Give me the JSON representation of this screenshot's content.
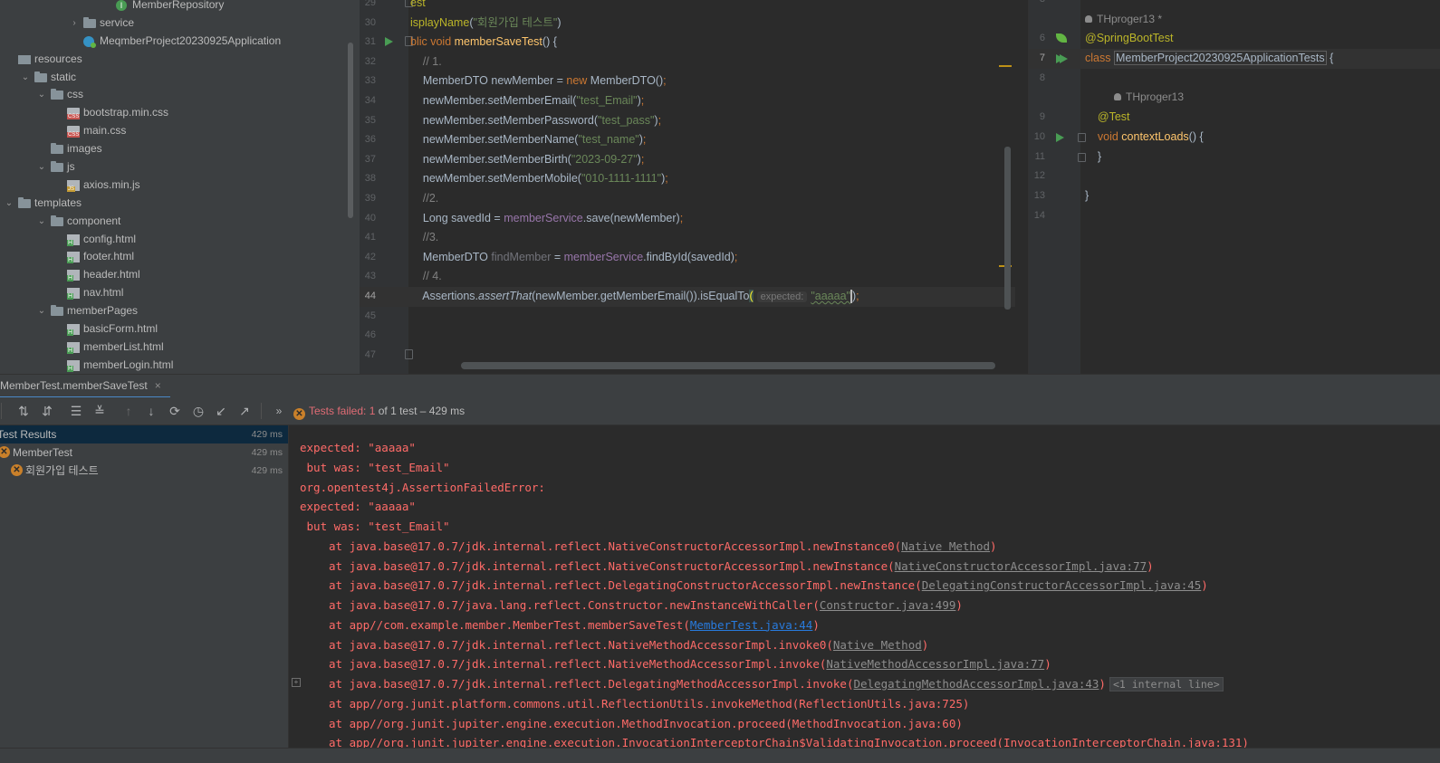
{
  "project_tree": {
    "items": [
      {
        "label": "MemberRepository",
        "icon": "interface-icon",
        "depth": 6,
        "arrow": ""
      },
      {
        "label": "service",
        "icon": "folder-icon",
        "depth": 4,
        "arrow": "collapsed"
      },
      {
        "label": "MeqmberProject20230925Application",
        "icon": "spring-app-icon",
        "depth": 4,
        "arrow": ""
      },
      {
        "label": "resources",
        "icon": "resources-folder-icon",
        "depth": 0,
        "arrow": ""
      },
      {
        "label": "static",
        "icon": "folder-icon",
        "depth": 1,
        "arrow": "expanded"
      },
      {
        "label": "css",
        "icon": "folder-icon",
        "depth": 2,
        "arrow": "expanded"
      },
      {
        "label": "bootstrap.min.css",
        "icon": "css-file-icon",
        "depth": 3,
        "arrow": ""
      },
      {
        "label": "main.css",
        "icon": "css-file-icon",
        "depth": 3,
        "arrow": ""
      },
      {
        "label": "images",
        "icon": "folder-icon",
        "depth": 2,
        "arrow": ""
      },
      {
        "label": "js",
        "icon": "folder-icon",
        "depth": 2,
        "arrow": "expanded"
      },
      {
        "label": "axios.min.js",
        "icon": "js-file-icon",
        "depth": 3,
        "arrow": ""
      },
      {
        "label": "templates",
        "icon": "folder-icon",
        "depth": 0,
        "arrow": "expanded"
      },
      {
        "label": "component",
        "icon": "folder-icon",
        "depth": 2,
        "arrow": "expanded"
      },
      {
        "label": "config.html",
        "icon": "html-file-icon",
        "depth": 3,
        "arrow": ""
      },
      {
        "label": "footer.html",
        "icon": "html-file-icon",
        "depth": 3,
        "arrow": ""
      },
      {
        "label": "header.html",
        "icon": "html-file-icon",
        "depth": 3,
        "arrow": ""
      },
      {
        "label": "nav.html",
        "icon": "html-file-icon",
        "depth": 3,
        "arrow": ""
      },
      {
        "label": "memberPages",
        "icon": "folder-icon",
        "depth": 2,
        "arrow": "expanded"
      },
      {
        "label": "basicForm.html",
        "icon": "html-file-icon",
        "depth": 3,
        "arrow": ""
      },
      {
        "label": "memberList.html",
        "icon": "html-file-icon",
        "depth": 3,
        "arrow": ""
      },
      {
        "label": "memberLogin.html",
        "icon": "html-file-icon",
        "depth": 3,
        "arrow": ""
      }
    ]
  },
  "editor_left": {
    "current_line": 44,
    "lines": [
      {
        "n": 29,
        "marker": "fold",
        "t": [
          [
            "ann",
            "est"
          ]
        ]
      },
      {
        "n": 30,
        "t": [
          [
            "ann",
            "isplayName"
          ],
          [
            "",
            "("
          ],
          [
            "str",
            "\"회원가입 테스트\""
          ],
          [
            "",
            ")"
          ]
        ]
      },
      {
        "n": 31,
        "marker": "run-fold",
        "t": [
          [
            "kw",
            "blic void "
          ],
          [
            "fn",
            "memberSaveTest"
          ],
          [
            "",
            "() {"
          ]
        ]
      },
      {
        "n": 32,
        "t": [
          [
            "cm",
            "    // 1."
          ]
        ]
      },
      {
        "n": 33,
        "t": [
          [
            "",
            "    MemberDTO newMember = "
          ],
          [
            "kw",
            "new "
          ],
          [
            "",
            "MemberDTO()"
          ],
          [
            "kw",
            ";"
          ]
        ]
      },
      {
        "n": 34,
        "t": [
          [
            "",
            "    newMember.setMemberEmail("
          ],
          [
            "str",
            "\"test_Email\""
          ],
          [
            "",
            ")"
          ],
          [
            "kw",
            ";"
          ]
        ]
      },
      {
        "n": 35,
        "t": [
          [
            "",
            "    newMember.setMemberPassword("
          ],
          [
            "str",
            "\"test_pass\""
          ],
          [
            "",
            ")"
          ],
          [
            "kw",
            ";"
          ]
        ]
      },
      {
        "n": 36,
        "t": [
          [
            "",
            "    newMember.setMemberName("
          ],
          [
            "str",
            "\"test_name\""
          ],
          [
            "",
            ")"
          ],
          [
            "kw",
            ";"
          ]
        ]
      },
      {
        "n": 37,
        "t": [
          [
            "",
            "    newMember.setMemberBirth("
          ],
          [
            "str",
            "\"2023-09-27\""
          ],
          [
            "",
            ")"
          ],
          [
            "kw",
            ";"
          ]
        ]
      },
      {
        "n": 38,
        "t": [
          [
            "",
            "    newMember.setMemberMobile("
          ],
          [
            "str",
            "\"010-1111-1111\""
          ],
          [
            "",
            ")"
          ],
          [
            "kw",
            ";"
          ]
        ]
      },
      {
        "n": 39,
        "t": [
          [
            "cm",
            "    //2."
          ]
        ]
      },
      {
        "n": 40,
        "t": [
          [
            "",
            "    Long savedId = "
          ],
          [
            "fld",
            "memberService"
          ],
          [
            "",
            ".save(newMember)"
          ],
          [
            "kw",
            ";"
          ]
        ]
      },
      {
        "n": 41,
        "t": [
          [
            "cm",
            "    //3."
          ]
        ]
      },
      {
        "n": 42,
        "t": [
          [
            "",
            "    MemberDTO "
          ],
          [
            "unused",
            "findMember"
          ],
          [
            "",
            " = "
          ],
          [
            "fld",
            "memberService"
          ],
          [
            "",
            ".findById(savedId)"
          ],
          [
            "kw",
            ";"
          ]
        ]
      },
      {
        "n": 43,
        "t": [
          [
            "cm",
            "    // 4."
          ]
        ]
      },
      {
        "n": 44,
        "t": [
          [
            "",
            "    Assertions."
          ],
          [
            "ital",
            "assertThat"
          ],
          [
            "",
            "(newMember.getMemberEmail()).isEqualTo"
          ],
          [
            "paren",
            "("
          ],
          [
            "hint",
            "expected:"
          ],
          [
            "strtypo",
            "\"aaaaa\""
          ],
          [
            "caret",
            ""
          ],
          [
            "",
            ")"
          ],
          [
            "kw",
            ";"
          ]
        ]
      },
      {
        "n": 45,
        "t": []
      },
      {
        "n": 46,
        "t": []
      },
      {
        "n": 47,
        "marker": "fold",
        "t": []
      }
    ]
  },
  "editor_right": {
    "current_line": 7,
    "lines": [
      {
        "n": "3",
        "t": []
      },
      {
        "n": "",
        "author": "THproger13 *",
        "indent": 0
      },
      {
        "n": "6",
        "marker": "leaf",
        "t": [
          [
            "ann",
            "@SpringBootTest"
          ]
        ]
      },
      {
        "n": "7",
        "marker": "run2",
        "t": [
          [
            "kw",
            "class "
          ],
          [
            "cls",
            "MemberProject20230925ApplicationTests"
          ],
          [
            "",
            " {"
          ]
        ]
      },
      {
        "n": "8",
        "t": []
      },
      {
        "n": "",
        "author": "THproger13",
        "indent": 1
      },
      {
        "n": "9",
        "t": [
          [
            "ann",
            "    @Test"
          ]
        ]
      },
      {
        "n": "10",
        "marker": "run-fold",
        "t": [
          [
            "kw",
            "    void "
          ],
          [
            "fn",
            "contextLoads"
          ],
          [
            "",
            "() {"
          ]
        ]
      },
      {
        "n": "11",
        "marker": "fold",
        "t": [
          [
            "",
            "    }"
          ]
        ]
      },
      {
        "n": "12",
        "t": []
      },
      {
        "n": "13",
        "t": [
          [
            "",
            "}"
          ]
        ]
      },
      {
        "n": "14",
        "t": []
      }
    ]
  },
  "run_panel": {
    "tab_label": "MemberTest.memberSaveTest",
    "tab_close": "×",
    "status": {
      "prefix": "Tests failed:",
      "count": "1",
      "suffix": "of 1 test – 429 ms"
    },
    "results": [
      {
        "label": "Test Results",
        "time": "429 ms",
        "depth": 0,
        "status": "",
        "selected": true
      },
      {
        "label": "MemberTest",
        "time": "429 ms",
        "depth": 0,
        "status": "failed",
        "selected": false
      },
      {
        "label": "회원가입 테스트",
        "time": "429 ms",
        "depth": 1,
        "status": "failed",
        "selected": false
      }
    ],
    "console": [
      {
        "t": "expected: \"aaaaa\""
      },
      {
        "t": " but was: \"test_Email\""
      },
      {
        "t": "org.opentest4j.AssertionFailedError:"
      },
      {
        "t": "expected: \"aaaaa\""
      },
      {
        "t": " but was: \"test_Email\""
      },
      {
        "at": "at java.base@17.0.7/jdk.internal.reflect.NativeConstructorAccessorImpl.newInstance0(",
        "link": "Native Method",
        "end": ")"
      },
      {
        "at": "at java.base@17.0.7/jdk.internal.reflect.NativeConstructorAccessorImpl.newInstance(",
        "link": "NativeConstructorAccessorImpl.java:77",
        "end": ")"
      },
      {
        "at": "at java.base@17.0.7/jdk.internal.reflect.DelegatingConstructorAccessorImpl.newInstance(",
        "link": "DelegatingConstructorAccessorImpl.java:45",
        "end": ")"
      },
      {
        "at": "at java.base@17.0.7/java.lang.reflect.Constructor.newInstanceWithCaller(",
        "link": "Constructor.java:499",
        "end": ")"
      },
      {
        "at": "at app//com.example.member.MemberTest.memberSaveTest(",
        "link": "MemberTest.java:44",
        "end": ")",
        "user": true
      },
      {
        "at": "at java.base@17.0.7/jdk.internal.reflect.NativeMethodAccessorImpl.invoke0(",
        "link": "Native Method",
        "end": ")"
      },
      {
        "at": "at java.base@17.0.7/jdk.internal.reflect.NativeMethodAccessorImpl.invoke(",
        "link": "NativeMethodAccessorImpl.java:77",
        "end": ")"
      },
      {
        "at": "at java.base@17.0.7/jdk.internal.reflect.DelegatingMethodAccessorImpl.invoke(",
        "link": "DelegatingMethodAccessorImpl.java:43",
        "end": ")",
        "badge": "<1 internal line>"
      },
      {
        "at": "at app//org.junit.platform.commons.util.ReflectionUtils.invokeMethod(ReflectionUtils.java:725)"
      },
      {
        "at": "at app//org.junit.jupiter.engine.execution.MethodInvocation.proceed(MethodInvocation.java:60)"
      },
      {
        "at": "at app//org.junit.jupiter.engine.execution.InvocationInterceptorChain$ValidatingInvocation.proceed(InvocationInterceptorChain.java:131)"
      }
    ]
  },
  "colors": {
    "accent": "#4a88c7",
    "error": "#ff6b68",
    "pass": "#499c54",
    "warning": "#c9802a"
  }
}
